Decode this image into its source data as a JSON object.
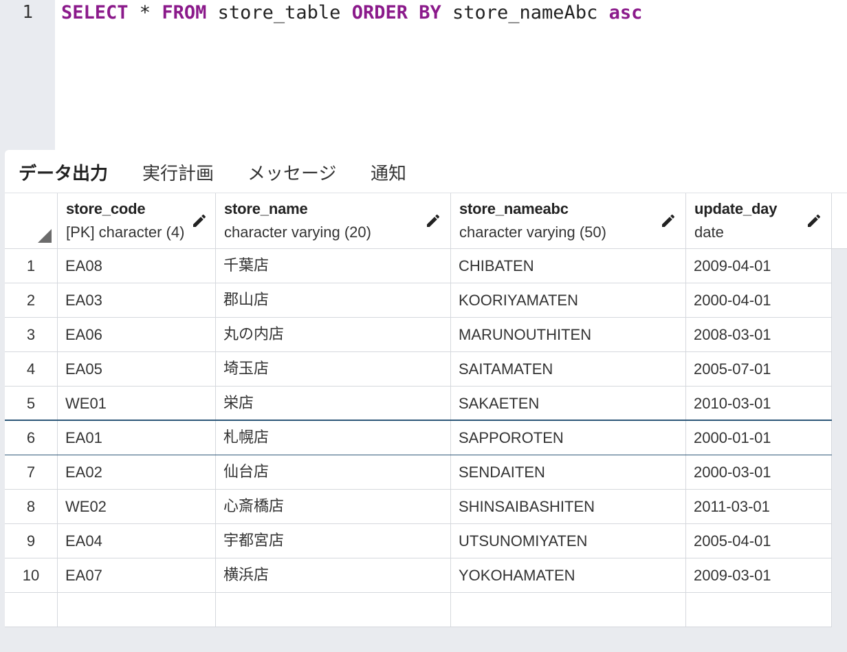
{
  "editor": {
    "line_number": "1",
    "query": {
      "select": "SELECT",
      "star": " * ",
      "from": "FROM",
      "table": " store_table ",
      "order": "ORDER",
      "by": "BY",
      "column": " store_nameAbc ",
      "direction": "asc"
    }
  },
  "tabs": {
    "data_output": "データ出力",
    "explain": "実行計画",
    "messages": "メッセージ",
    "notifications": "通知"
  },
  "columns": [
    {
      "name": "store_code",
      "type": "[PK] character (4)"
    },
    {
      "name": "store_name",
      "type": "character varying (20)"
    },
    {
      "name": "store_nameabc",
      "type": "character varying (50)"
    },
    {
      "name": "update_day",
      "type": "date"
    }
  ],
  "rows": [
    {
      "n": "1",
      "code": "EA08",
      "name": "千葉店",
      "abc": "CHIBATEN",
      "day": "2009-04-01"
    },
    {
      "n": "2",
      "code": "EA03",
      "name": "郡山店",
      "abc": "KOORIYAMATEN",
      "day": "2000-04-01"
    },
    {
      "n": "3",
      "code": "EA06",
      "name": "丸の内店",
      "abc": "MARUNOUTHITEN",
      "day": "2008-03-01"
    },
    {
      "n": "4",
      "code": "EA05",
      "name": "埼玉店",
      "abc": "SAITAMATEN",
      "day": "2005-07-01"
    },
    {
      "n": "5",
      "code": "WE01",
      "name": "栄店",
      "abc": "SAKAETEN",
      "day": "2010-03-01"
    },
    {
      "n": "6",
      "code": "EA01",
      "name": "札幌店",
      "abc": "SAPPOROTEN",
      "day": "2000-01-01"
    },
    {
      "n": "7",
      "code": "EA02",
      "name": "仙台店",
      "abc": "SENDAITEN",
      "day": "2000-03-01"
    },
    {
      "n": "8",
      "code": "WE02",
      "name": "心斎橋店",
      "abc": "SHINSAIBASHITEN",
      "day": "2011-03-01"
    },
    {
      "n": "9",
      "code": "EA04",
      "name": "宇都宮店",
      "abc": "UTSUNOMIYATEN",
      "day": "2005-04-01"
    },
    {
      "n": "10",
      "code": "EA07",
      "name": "横浜店",
      "abc": "YOKOHAMATEN",
      "day": "2009-03-01"
    }
  ],
  "selected_row": "6",
  "icons": {
    "edit_column": "pencil-icon",
    "select_all": "corner-triangle-icon"
  }
}
